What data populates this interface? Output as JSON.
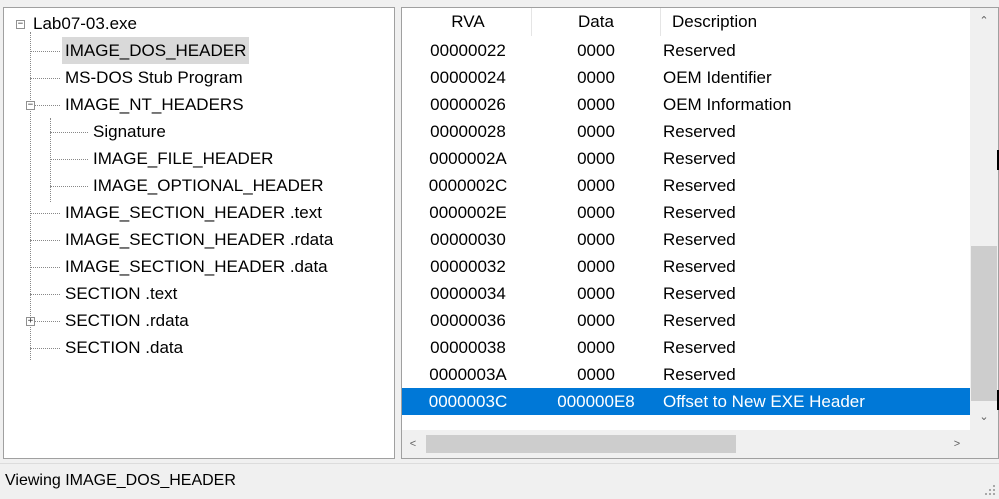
{
  "tree": {
    "items": [
      {
        "label": "Lab07-03.exe"
      },
      {
        "label": "IMAGE_DOS_HEADER"
      },
      {
        "label": "MS-DOS Stub Program"
      },
      {
        "label": "IMAGE_NT_HEADERS"
      },
      {
        "label": "Signature"
      },
      {
        "label": "IMAGE_FILE_HEADER"
      },
      {
        "label": "IMAGE_OPTIONAL_HEADER"
      },
      {
        "label": "IMAGE_SECTION_HEADER .text"
      },
      {
        "label": "IMAGE_SECTION_HEADER .rdata"
      },
      {
        "label": "IMAGE_SECTION_HEADER .data"
      },
      {
        "label": "SECTION .text"
      },
      {
        "label": "SECTION .rdata"
      },
      {
        "label": "SECTION .data"
      }
    ]
  },
  "list": {
    "columns": {
      "rva": "RVA",
      "data": "Data",
      "description": "Description"
    },
    "rows": [
      {
        "rva": "00000022",
        "data": "0000",
        "description": "Reserved"
      },
      {
        "rva": "00000024",
        "data": "0000",
        "description": "OEM Identifier"
      },
      {
        "rva": "00000026",
        "data": "0000",
        "description": "OEM Information"
      },
      {
        "rva": "00000028",
        "data": "0000",
        "description": "Reserved"
      },
      {
        "rva": "0000002A",
        "data": "0000",
        "description": "Reserved"
      },
      {
        "rva": "0000002C",
        "data": "0000",
        "description": "Reserved"
      },
      {
        "rva": "0000002E",
        "data": "0000",
        "description": "Reserved"
      },
      {
        "rva": "00000030",
        "data": "0000",
        "description": "Reserved"
      },
      {
        "rva": "00000032",
        "data": "0000",
        "description": "Reserved"
      },
      {
        "rva": "00000034",
        "data": "0000",
        "description": "Reserved"
      },
      {
        "rva": "00000036",
        "data": "0000",
        "description": "Reserved"
      },
      {
        "rva": "00000038",
        "data": "0000",
        "description": "Reserved"
      },
      {
        "rva": "0000003A",
        "data": "0000",
        "description": "Reserved"
      },
      {
        "rva": "0000003C",
        "data": "000000E8",
        "description": "Offset to New EXE Header"
      }
    ]
  },
  "status": {
    "text": "Viewing IMAGE_DOS_HEADER"
  },
  "colors": {
    "selection": "#0078d7",
    "tree_selection": "#d9d9d9"
  }
}
